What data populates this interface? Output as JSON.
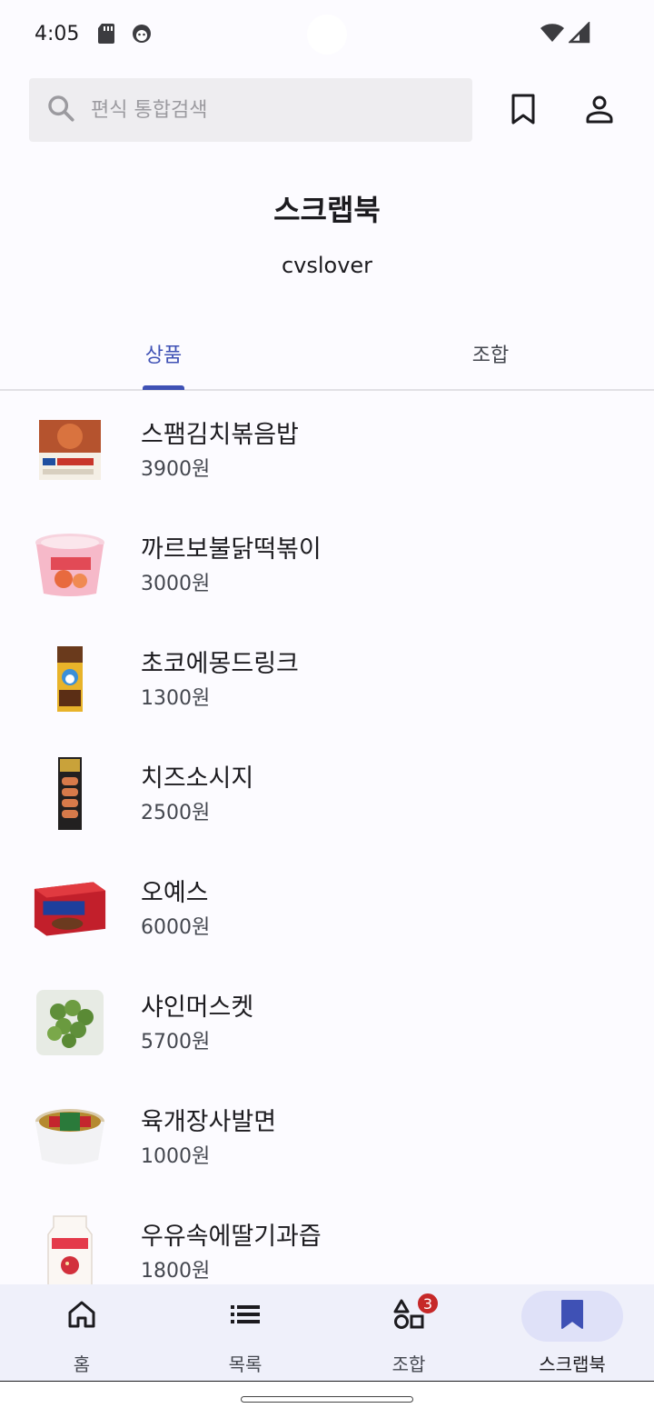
{
  "status_bar": {
    "time": "4:05"
  },
  "search": {
    "placeholder": "편식 통합검색",
    "value": ""
  },
  "header": {
    "title": "스크랩북",
    "username": "cvslover"
  },
  "tabs": [
    {
      "label": "상품",
      "selected": true
    },
    {
      "label": "조합",
      "selected": false
    }
  ],
  "products": [
    {
      "name": "스팸김치볶음밥",
      "price": "3900원"
    },
    {
      "name": "까르보불닭떡볶이",
      "price": "3000원"
    },
    {
      "name": "초코에몽드링크",
      "price": "1300원"
    },
    {
      "name": "치즈소시지",
      "price": "2500원"
    },
    {
      "name": "오예스",
      "price": "6000원"
    },
    {
      "name": "샤인머스켓",
      "price": "5700원"
    },
    {
      "name": "육개장사발면",
      "price": "1000원"
    },
    {
      "name": "우유속에딸기과즙",
      "price": "1800원"
    }
  ],
  "bottom_nav": [
    {
      "label": "홈",
      "icon": "home-icon"
    },
    {
      "label": "목록",
      "icon": "list-icon"
    },
    {
      "label": "조합",
      "icon": "shapes-icon",
      "badge": "3"
    },
    {
      "label": "스크랩북",
      "icon": "bookmark-icon",
      "active": true
    }
  ],
  "colors": {
    "accent": "#3f51b5",
    "background": "#fcfbff",
    "nav_background": "#eff0fa",
    "badge": "#c62828"
  }
}
